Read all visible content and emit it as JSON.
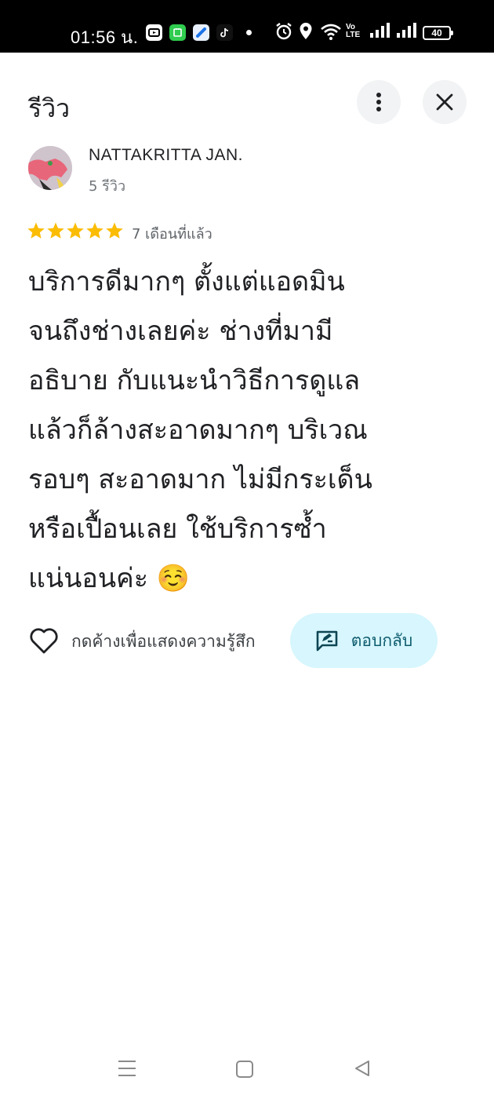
{
  "status_bar": {
    "time": "01:56 น.",
    "battery": "40",
    "network_label": "Vo LTE"
  },
  "header": {
    "title": "รีวิว"
  },
  "reviewer": {
    "name": "NATTAKRITTA JAN.",
    "review_count": "5 รีวิว"
  },
  "review": {
    "rating": 5,
    "max_rating": 5,
    "time_ago": "7 เดือนที่แล้ว",
    "lines": [
      "บริการดีมากๆ ตั้งแต่แอดมิน",
      "จนถึงช่างเลยค่ะ ช่างที่มามี",
      "อธิบาย กับแนะนำวิธีการดูแล",
      "แล้วก็ล้างสะอาดมากๆ บริเวณ",
      "รอบๆ สะอาดมาก ไม่มีกระเด็น",
      "หรือเปื้อนเลย ใช้บริการซ้ำ",
      "แน่นอนค่ะ ☺️"
    ]
  },
  "actions": {
    "like_label": "กดค้างเพื่อแสดงความรู้สึก",
    "reply_label": "ตอบกลับ"
  },
  "colors": {
    "star": "#fbbc04",
    "reply_bg": "#d7f6fd",
    "reply_text": "#0e5c6e"
  },
  "icons": [
    "more-vert-icon",
    "close-icon",
    "heart-outline-icon",
    "reply-icon",
    "menu-icon",
    "home-square-icon",
    "back-triangle-icon"
  ]
}
